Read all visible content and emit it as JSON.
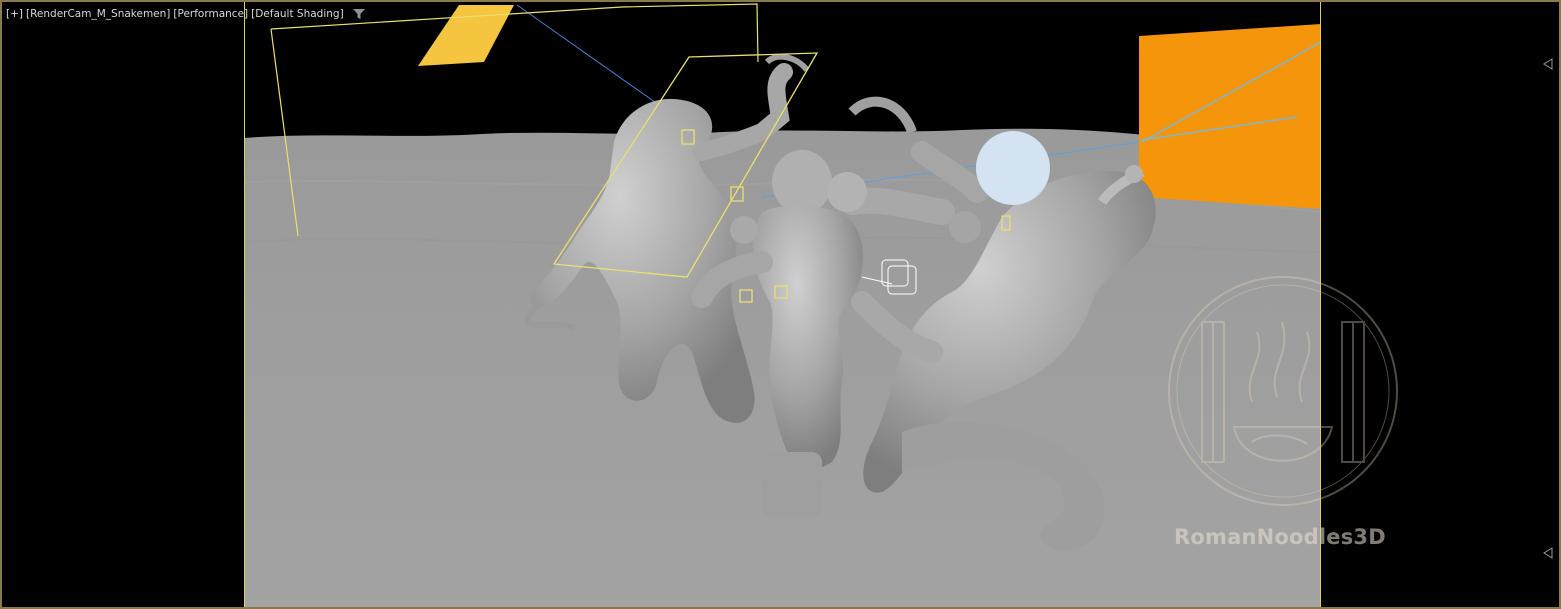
{
  "viewport": {
    "labels": [
      "[+]",
      "[RenderCam_M_Snakemen]",
      "[Performance]",
      "[Default Shading]"
    ],
    "filter_icon": "funnel-icon"
  },
  "watermark": {
    "text": "RomanNoodles3D",
    "logo_icon": "noodle-bowl-columns-logo"
  },
  "colors": {
    "frame_border": "#8a7a4a",
    "safe_frame": "#d6cf64",
    "ground": "#9b9b9b",
    "sky": "#000000",
    "light_orange": "#f5960a",
    "light_yellow": "#f5c540",
    "light_sphere": "#d4e3f2",
    "model_grey": "#a8a8a8"
  }
}
